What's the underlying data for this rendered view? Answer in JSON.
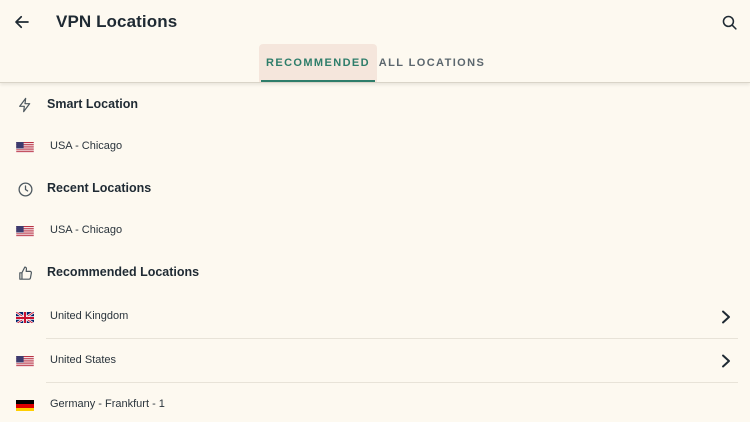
{
  "header": {
    "title": "VPN Locations",
    "back_icon": "arrow-left-icon",
    "search_icon": "search-icon"
  },
  "tabs": [
    {
      "label": "RECOMMENDED",
      "active": true
    },
    {
      "label": "ALL LOCATIONS",
      "active": false
    }
  ],
  "sections": {
    "smart": {
      "title": "Smart Location",
      "icon": "lightning-icon",
      "items": [
        {
          "label": "USA - Chicago",
          "flag": "us-flag-icon"
        }
      ]
    },
    "recent": {
      "title": "Recent Locations",
      "icon": "clock-icon",
      "items": [
        {
          "label": "USA - Chicago",
          "flag": "us-flag-icon"
        }
      ]
    },
    "recommended": {
      "title": "Recommended Locations",
      "icon": "thumbs-up-icon",
      "items": [
        {
          "label": "United Kingdom",
          "flag": "uk-flag-icon",
          "has_chevron": true
        },
        {
          "label": "United States",
          "flag": "us-flag-icon",
          "has_chevron": true
        },
        {
          "label": "Germany - Frankfurt - 1",
          "flag": "de-flag-icon",
          "has_chevron": false
        }
      ]
    }
  },
  "colors": {
    "background": "#fdf9f0",
    "accent": "#2e7d6a",
    "active_tab_bg": "#f5e6dc",
    "text": "#1f2a33"
  }
}
